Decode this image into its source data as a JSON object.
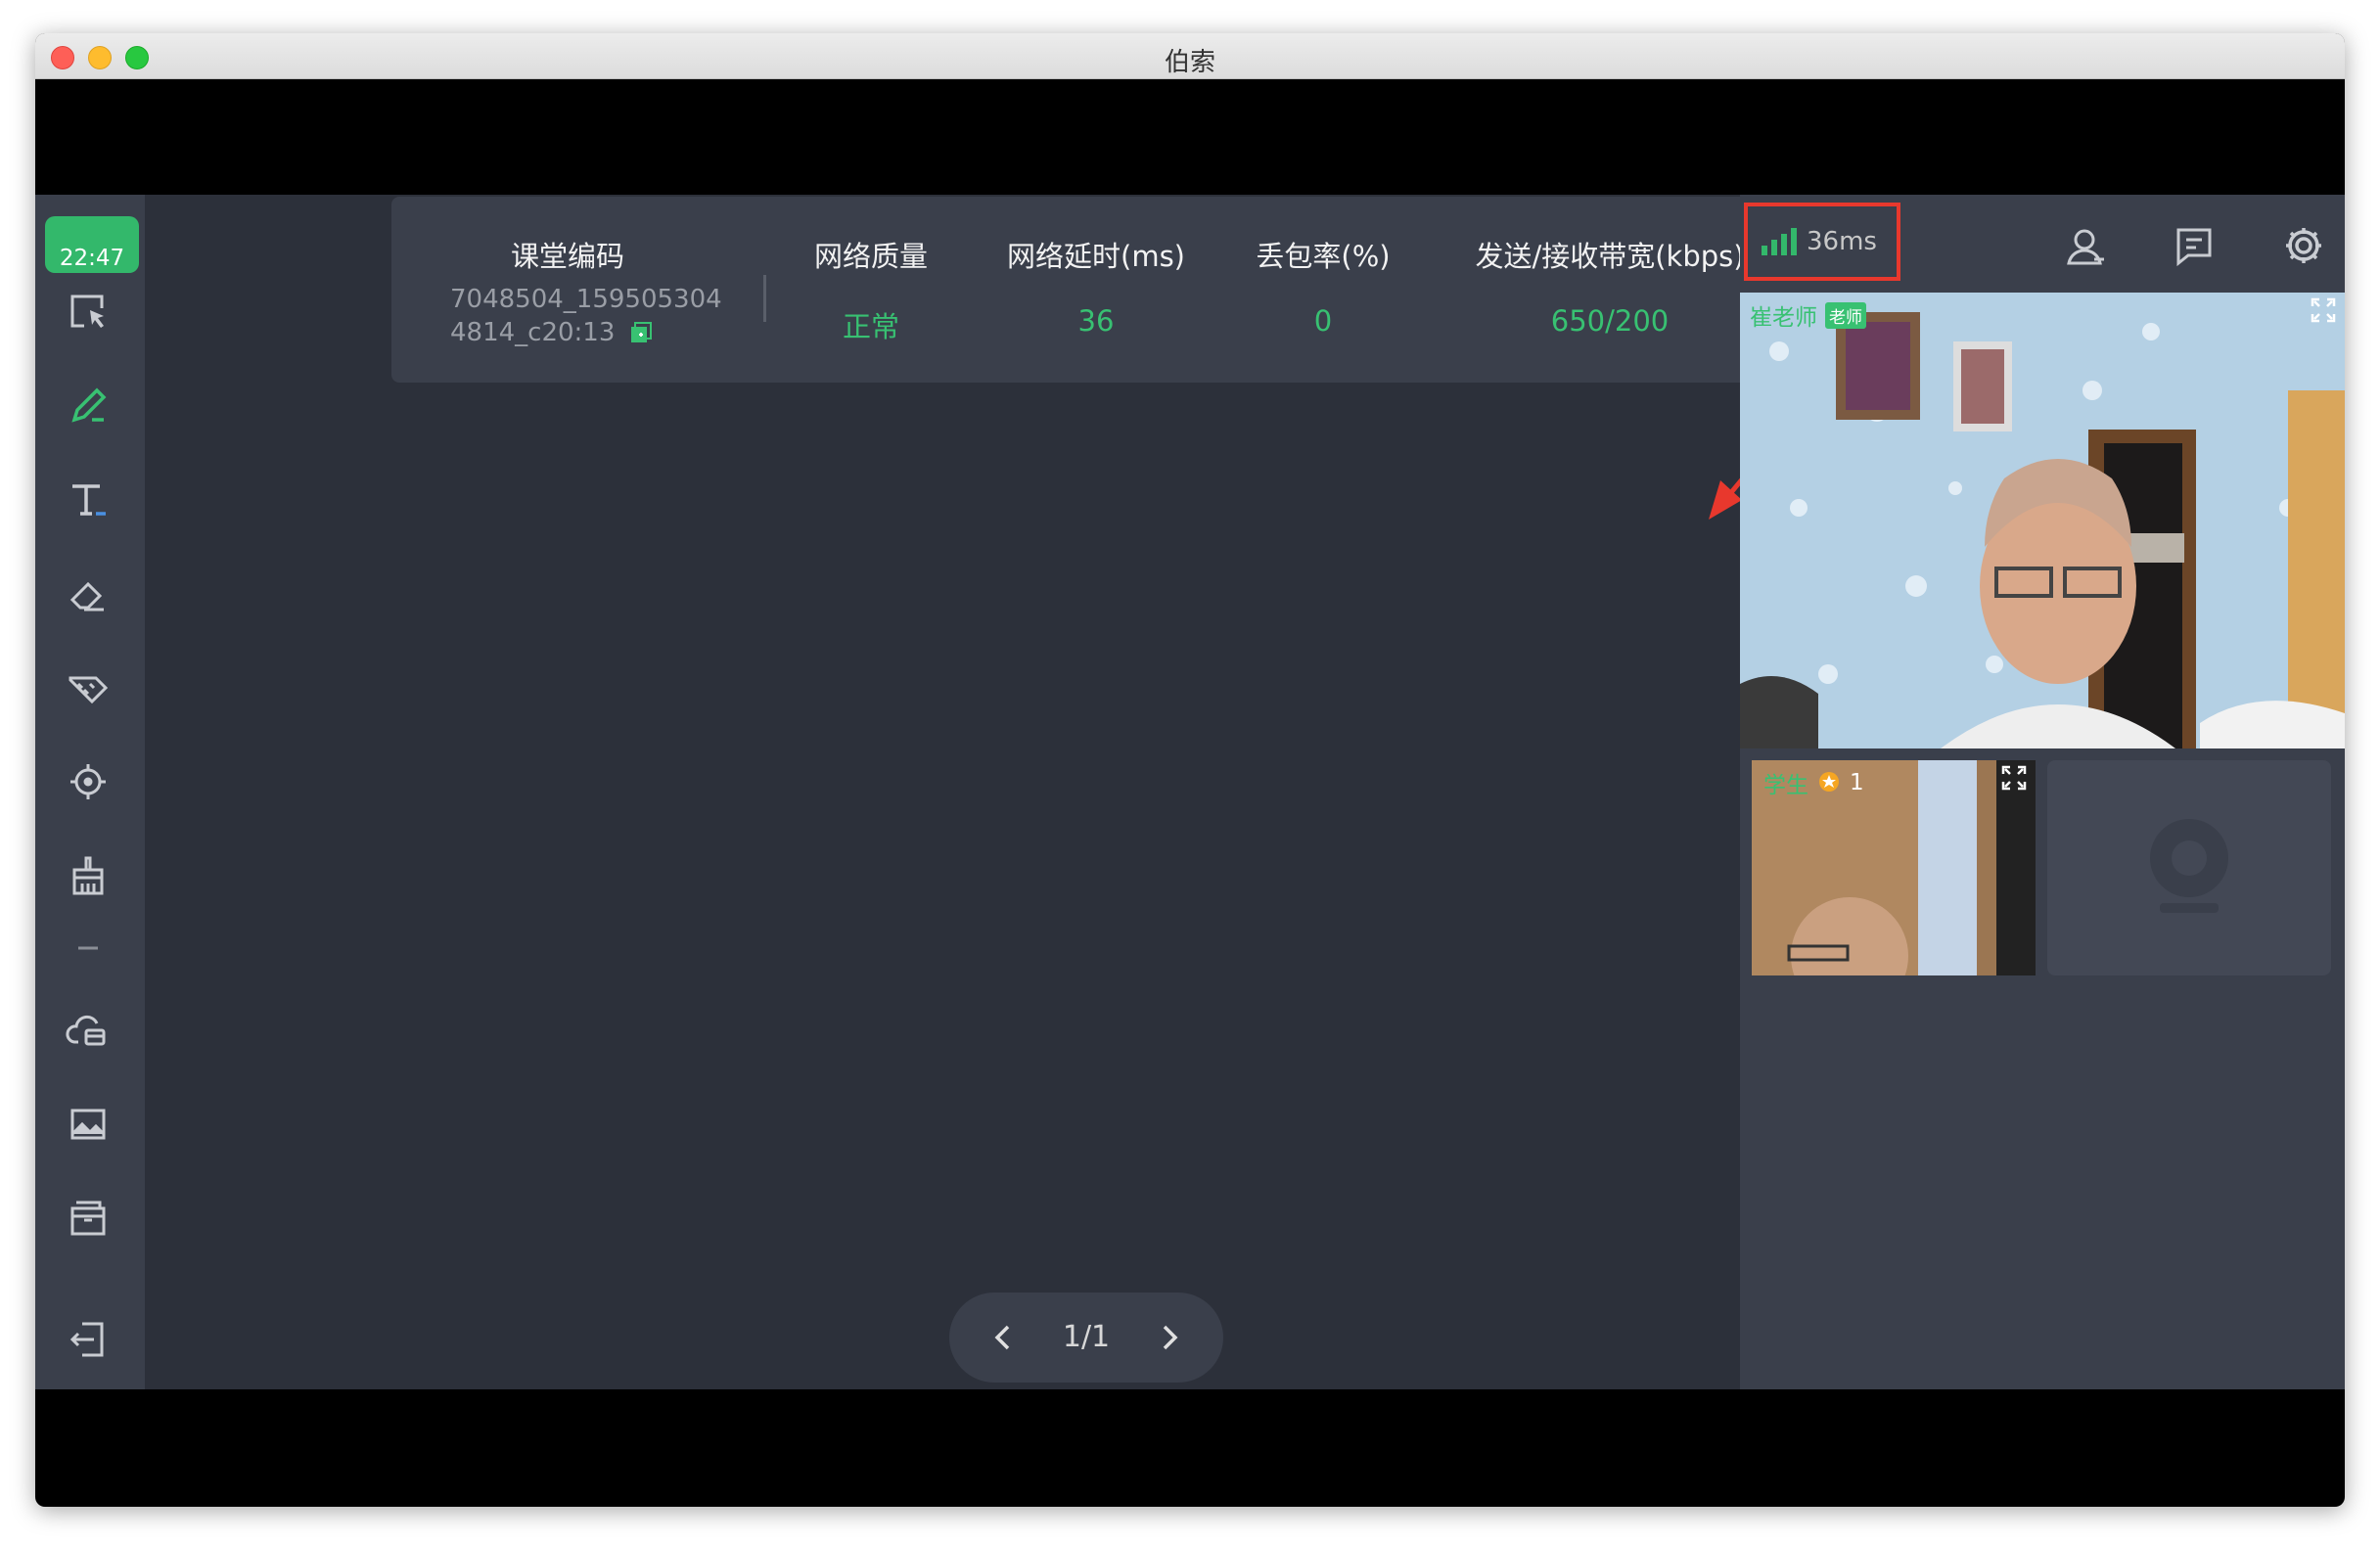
{
  "window": {
    "title": "伯索"
  },
  "toolbar": {
    "clock": "22:47",
    "tools": [
      "select-icon",
      "pen-icon",
      "text-icon",
      "eraser-icon",
      "ruler-icon",
      "laser-pointer-icon",
      "clear-board-icon",
      "separator",
      "cloud-drive-icon",
      "image-icon",
      "archive-icon",
      "exit-icon"
    ]
  },
  "stats": {
    "headers": {
      "code": "课堂编码",
      "quality": "网络质量",
      "latency": "网络延时(ms)",
      "loss": "丢包率(%)",
      "bandwidth": "发送/接收带宽(kbps)"
    },
    "values": {
      "code_line1": "7048504_159505304",
      "code_line2": "4814_c20:13",
      "quality": "正常",
      "latency": "36",
      "loss": "0",
      "bandwidth": "650/200"
    }
  },
  "pager": {
    "page": "1/1"
  },
  "panel": {
    "network_latency": "36ms",
    "signal_bars": 4,
    "teacher": {
      "name": "崔老师",
      "tag": "老师"
    },
    "student": {
      "name": "学生",
      "stars": "1"
    }
  },
  "colors": {
    "accent": "#38c172",
    "highlight_box": "#e8382d",
    "panel_bg": "#3a3f4b",
    "board_bg": "#2c303a"
  }
}
